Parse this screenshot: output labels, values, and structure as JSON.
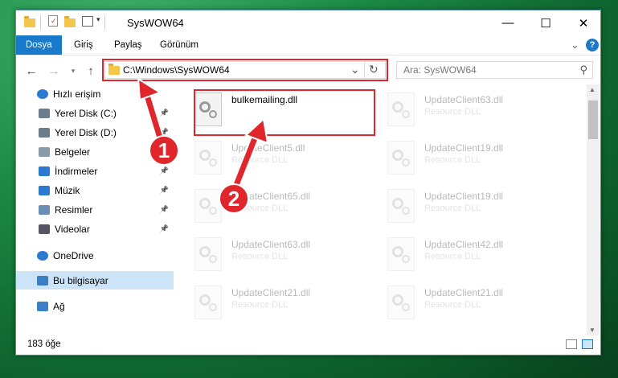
{
  "window": {
    "title": "SysWOW64",
    "minimize": "—",
    "maximize": "☐",
    "close": "✕"
  },
  "ribbon": {
    "tabs": [
      "Dosya",
      "Giriş",
      "Paylaş",
      "Görünüm"
    ],
    "expand": "⌄",
    "help": "?"
  },
  "address": {
    "path": "C:\\Windows\\SysWOW64",
    "search_placeholder": "Ara: SysWOW64",
    "refresh": "↻",
    "dropdown": "⌄"
  },
  "nav": {
    "items": [
      {
        "label": "Hızlı erişim",
        "icon": "star-icon"
      },
      {
        "label": "Yerel Disk (C:)",
        "icon": "drive-icon",
        "pinned": true
      },
      {
        "label": "Yerel Disk (D:)",
        "icon": "drive-icon",
        "pinned": true
      },
      {
        "label": "Belgeler",
        "icon": "documents-icon",
        "pinned": true
      },
      {
        "label": "İndirmeler",
        "icon": "download-icon",
        "pinned": true
      },
      {
        "label": "Müzik",
        "icon": "music-icon",
        "pinned": true
      },
      {
        "label": "Resimler",
        "icon": "pictures-icon",
        "pinned": true
      },
      {
        "label": "Videolar",
        "icon": "videos-icon",
        "pinned": true
      },
      {
        "label": "OneDrive",
        "icon": "cloud-icon"
      },
      {
        "label": "Bu bilgisayar",
        "icon": "computer-icon",
        "selected": true
      },
      {
        "label": "Ağ",
        "icon": "network-icon"
      }
    ]
  },
  "files": [
    {
      "name": "bulkemailing.dll",
      "type": ""
    },
    {
      "name": "UpdateClient63.dll",
      "type": "Resource DLL"
    },
    {
      "name": "UpdateClient5.dll",
      "type": "Resource DLL"
    },
    {
      "name": "UpdateClient19.dll",
      "type": "Resource DLL"
    },
    {
      "name": "UpdateClient65.dll",
      "type": "Resource DLL"
    },
    {
      "name": "UpdateClient19.dll",
      "type": "Resource DLL"
    },
    {
      "name": "UpdateClient63.dll",
      "type": "Resource DLL"
    },
    {
      "name": "UpdateClient42.dll",
      "type": "Resource DLL"
    },
    {
      "name": "UpdateClient21.dll",
      "type": "Resource DLL"
    },
    {
      "name": "UpdateClient21.dll",
      "type": "Resource DLL"
    }
  ],
  "status": {
    "count": "183 öğe"
  },
  "annotations": {
    "step1": "1",
    "step2": "2"
  },
  "colors": {
    "accent": "#1979ca",
    "highlight": "#e0252b",
    "selection": "#cce4f7"
  }
}
